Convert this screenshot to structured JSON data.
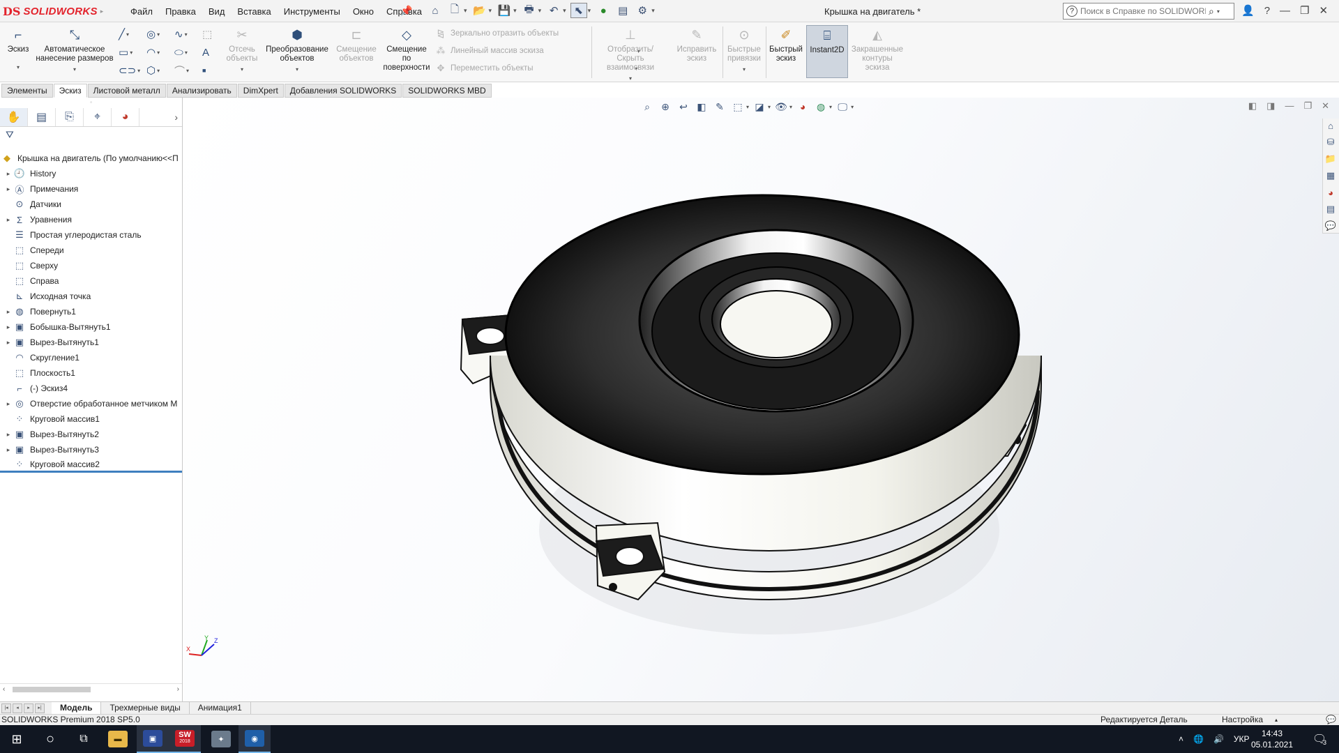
{
  "app": {
    "brand_prefix": "DS",
    "brand": "SOLIDWORKS",
    "document_title": "Крышка на двигатель *"
  },
  "menu": [
    "Файл",
    "Правка",
    "Вид",
    "Вставка",
    "Инструменты",
    "Окно",
    "Справка"
  ],
  "search": {
    "placeholder": "Поиск в Справке по SOLIDWORKS",
    "value": ""
  },
  "ribbon": {
    "sketch": "Эскиз",
    "smart_dimension": "Автоматическое нанесение размеров",
    "trim": "Отсечь объекты",
    "convert": "Преобразование объектов",
    "offset": "Смещение объектов",
    "offset_surface": "Смещение по поверхности",
    "mirror": "Зеркально отразить объекты",
    "linear_pattern": "Линейный массив эскиза",
    "move": "Переместить объекты",
    "relations": "Отобразить/Скрыть взаимосвязи",
    "repair": "Исправить эскиз",
    "snaps": "Быстрые привязки",
    "rapid_sketch": "Быстрый эскиз",
    "instant2d": "Instant2D",
    "shaded_contours": "Закрашенные контуры эскиза"
  },
  "tabs": [
    "Элементы",
    "Эскиз",
    "Листовой металл",
    "Анализировать",
    "DimXpert",
    "Добавления SOLIDWORKS",
    "SOLIDWORKS MBD"
  ],
  "tree": {
    "root": "Крышка на двигатель  (По умолчанию<<П",
    "items": [
      {
        "label": "History",
        "icon": "history-icon",
        "expandable": true
      },
      {
        "label": "Примечания",
        "icon": "annotations-icon",
        "expandable": true
      },
      {
        "label": "Датчики",
        "icon": "sensors-icon",
        "expandable": false
      },
      {
        "label": "Уравнения",
        "icon": "equations-icon",
        "expandable": true
      },
      {
        "label": "Простая углеродистая сталь",
        "icon": "material-icon",
        "expandable": false
      },
      {
        "label": "Спереди",
        "icon": "plane-icon",
        "expandable": false
      },
      {
        "label": "Сверху",
        "icon": "plane-icon",
        "expandable": false
      },
      {
        "label": "Справа",
        "icon": "plane-icon",
        "expandable": false
      },
      {
        "label": "Исходная точка",
        "icon": "origin-icon",
        "expandable": false
      },
      {
        "label": "Повернуть1",
        "icon": "revolve-icon",
        "expandable": true
      },
      {
        "label": "Бобышка-Вытянуть1",
        "icon": "extrude-icon",
        "expandable": true
      },
      {
        "label": "Вырез-Вытянуть1",
        "icon": "extrude-icon",
        "expandable": true
      },
      {
        "label": "Скругление1",
        "icon": "fillet-icon",
        "expandable": false
      },
      {
        "label": "Плоскость1",
        "icon": "plane-icon",
        "expandable": false
      },
      {
        "label": "(-) Эскиз4",
        "icon": "sketch-icon",
        "expandable": false
      },
      {
        "label": "Отверстие обработанное метчиком М",
        "icon": "hole-icon",
        "expandable": true
      },
      {
        "label": "Круговой массив1",
        "icon": "pattern-icon",
        "expandable": false
      },
      {
        "label": "Вырез-Вытянуть2",
        "icon": "extrude-icon",
        "expandable": true
      },
      {
        "label": "Вырез-Вытянуть3",
        "icon": "extrude-icon",
        "expandable": true
      },
      {
        "label": "Круговой массив2",
        "icon": "pattern-icon",
        "expandable": false
      }
    ]
  },
  "bottom_tabs": [
    "Модель",
    "Трехмерные виды",
    "Анимация1"
  ],
  "status": {
    "version": "SOLIDWORKS Premium 2018 SP5.0",
    "mode": "Редактируется Деталь",
    "custom": "Настройка"
  },
  "taskbar": {
    "sw_badge": "SW",
    "sw_year": "2018",
    "lang": "УКР",
    "time": "14:43",
    "date": "05.01.2021",
    "notifications": "3"
  },
  "colors": {
    "brand": "#e3232c",
    "accent": "#3f7fbf",
    "taskbar": "#111722"
  }
}
